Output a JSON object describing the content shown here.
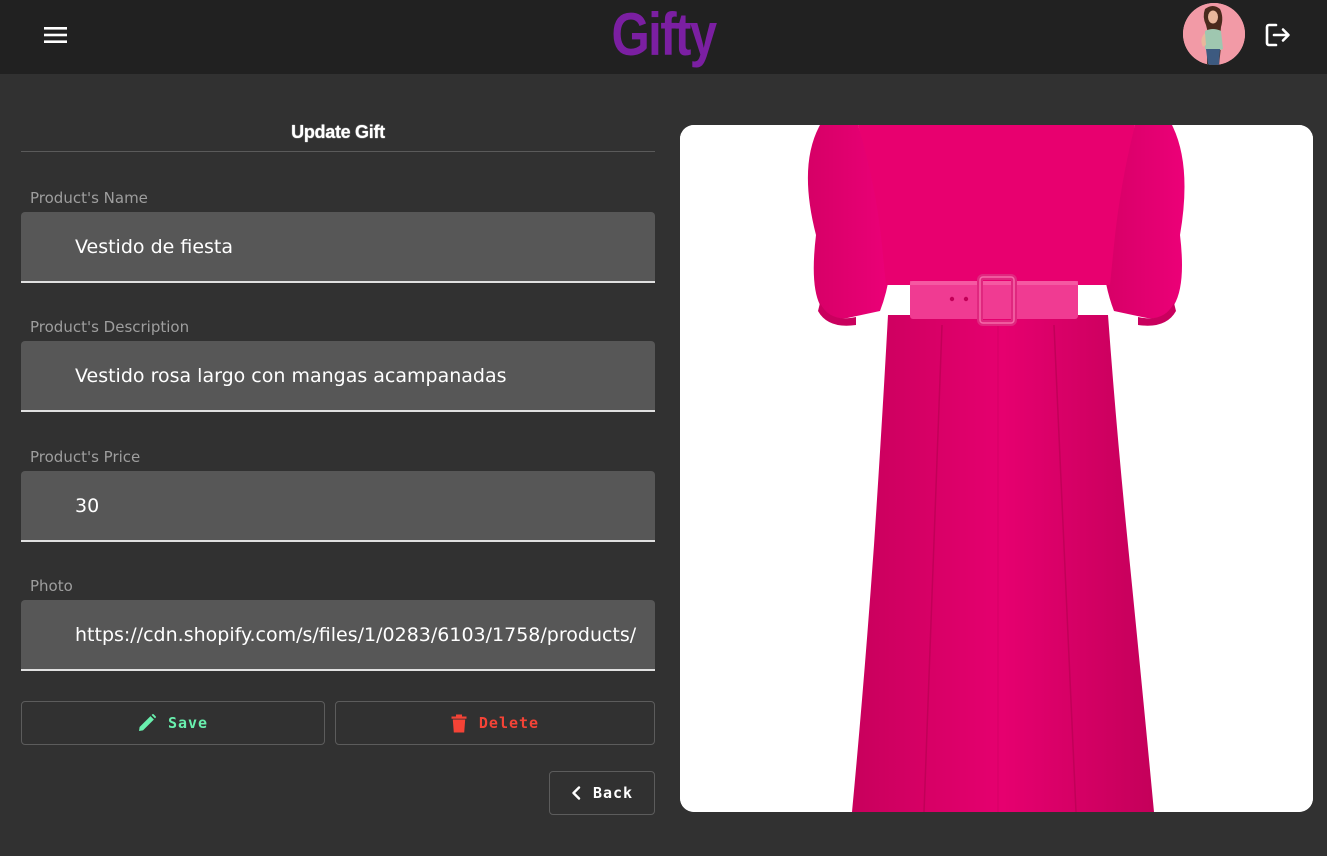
{
  "header": {
    "brand": "Gifty",
    "menu_icon": "menu-icon",
    "avatar_icon": "user-avatar",
    "logout_icon": "logout-icon",
    "brand_color": "#7b1fa2"
  },
  "form": {
    "title": "Update Gift",
    "fields": {
      "name": {
        "label": "Product's Name",
        "value": "Vestido de fiesta"
      },
      "description": {
        "label": "Product's Description",
        "value": "Vestido rosa largo con mangas acampanadas"
      },
      "price": {
        "label": "Product's Price",
        "value": "30"
      },
      "photo": {
        "label": "Photo",
        "value": "https://cdn.shopify.com/s/files/1/0283/6103/1758/products/"
      }
    },
    "buttons": {
      "save": {
        "label": "Save",
        "icon": "pencil-icon",
        "color": "#69f0ae"
      },
      "delete": {
        "label": "Delete",
        "icon": "trash-icon",
        "color": "#f44336"
      },
      "back": {
        "label": "Back",
        "icon": "chevron-left-icon"
      }
    }
  },
  "preview": {
    "subject": "pink-dress-photo",
    "dress_color": "#e3006d"
  }
}
